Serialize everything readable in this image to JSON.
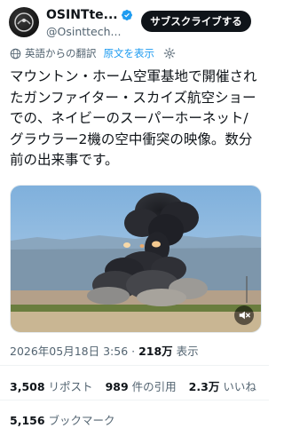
{
  "author": {
    "display_name": "OSINTte...",
    "handle": "@Osinttech..."
  },
  "subscribe_label": "サブスクライブする",
  "translation": {
    "label": "英語からの翻訳",
    "show_original": "原文を表示"
  },
  "tweet_text": "マウントン・ホーム空軍基地で開催されたガンファイター・スカイズ航空ショーでの、ネイビーのスーパーホーネット/グラウラー2機の空中衝突の映像。数分前の出来事です。",
  "meta": {
    "date": "2026年05月18日 3:56 · ",
    "views": "218万",
    "views_label": " 表示"
  },
  "stats": {
    "reposts": "3,508",
    "reposts_label": "リポスト",
    "quotes": "989",
    "quotes_label": "件の引用",
    "likes": "2.3万",
    "likes_label": "いいね"
  },
  "bookmarks": {
    "count": "5,156",
    "label": "ブックマーク"
  },
  "icons": [
    "verified-icon",
    "globe-icon",
    "gear-icon",
    "mute-icon"
  ],
  "colors": {
    "accent": "#1d9bf0",
    "text": "#0f1419",
    "secondary": "#536471"
  }
}
